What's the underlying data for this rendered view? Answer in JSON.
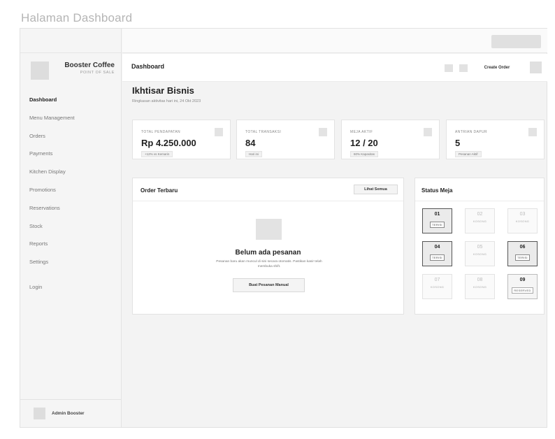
{
  "page": {
    "title": "Halaman Dashboard"
  },
  "sidebar": {
    "brand_name": "Booster Coffee",
    "brand_sub": "POINT OF SALE",
    "nav": [
      "Dashboard",
      "Menu Management",
      "Orders",
      "Payments",
      "Kitchen Display",
      "Promotions",
      "Reservations",
      "Stock",
      "Reports",
      "Settings",
      "Login"
    ],
    "active_item": "Dashboard",
    "user_name": "Admin Booster"
  },
  "header": {
    "title": "Dashboard",
    "create_order_label": "Create Order"
  },
  "overview": {
    "title": "Ikhtisar Bisnis",
    "subtitle": "Ringkasan aktivitas hari ini, 24 Okt 2023"
  },
  "stats": [
    {
      "label": "TOTAL PENDAPATAN",
      "value": "Rp 4.250.000",
      "note": "+12% vs Kemarin"
    },
    {
      "label": "TOTAL TRANSAKSI",
      "value": "84",
      "note": "Hari ini"
    },
    {
      "label": "MEJA AKTIF",
      "value": "12 / 20",
      "note": "60% Kapasitas"
    },
    {
      "label": "ANTRIAN DAPUR",
      "value": "5",
      "note": "Pesanan Aktif"
    }
  ],
  "orders": {
    "title": "Order Terbaru",
    "view_all_label": "Lihat Semua",
    "empty_title": "Belum ada pesanan",
    "empty_desc": "Pesanan baru akan muncul di sini secara otomatis. Pastikan kasir telah membuka shift.",
    "manual_button_label": "Buat Pesanan Manual"
  },
  "table_status": {
    "title": "Status Meja",
    "tables": [
      {
        "number": "01",
        "status": "TERISI",
        "state": "busy"
      },
      {
        "number": "02",
        "status": "KOSONG",
        "state": "empty"
      },
      {
        "number": "03",
        "status": "KOSONG",
        "state": "empty"
      },
      {
        "number": "04",
        "status": "TERISI",
        "state": "busy"
      },
      {
        "number": "05",
        "status": "KOSONG",
        "state": "empty"
      },
      {
        "number": "06",
        "status": "TERISI",
        "state": "busy"
      },
      {
        "number": "07",
        "status": "KOSONG",
        "state": "empty"
      },
      {
        "number": "08",
        "status": "KOSONG",
        "state": "empty"
      },
      {
        "number": "09",
        "status": "RESERVED",
        "state": "reserved"
      }
    ]
  }
}
